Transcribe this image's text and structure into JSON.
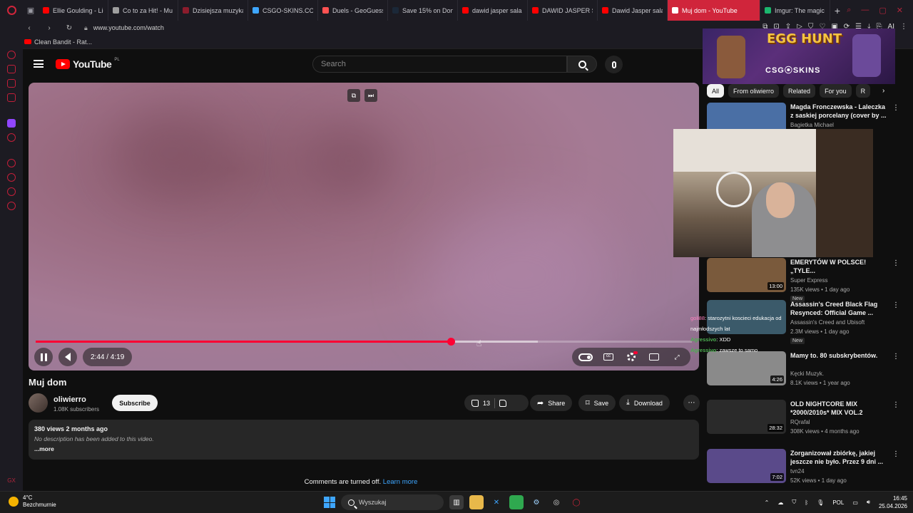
{
  "browser": {
    "tabs": [
      {
        "label": "Ellie Goulding - Lig",
        "color": "#ff0000"
      },
      {
        "label": "Co to za Hit! - Mu",
        "color": "#9e9e9e"
      },
      {
        "label": "Dzisiejsza muzyka",
        "color": "#8b1c2c"
      },
      {
        "label": "CSGO-SKINS.COM",
        "color": "#3ea6ff"
      },
      {
        "label": "Duels - GeoGuess",
        "color": "#ff5252"
      },
      {
        "label": "Save 15% on Don't",
        "color": "#1b2838"
      },
      {
        "label": "dawid jasper sala",
        "color": "#ff0000"
      },
      {
        "label": "DAWID JASPER S",
        "color": "#ff0000"
      },
      {
        "label": "Dawid Jasper sala",
        "color": "#ff0000"
      }
    ],
    "active_tab": "Muj dom - YouTube",
    "last_tab": "Imgur: The magic",
    "url": "www.youtube.com/watch",
    "bookmark": "Clean Bandit - Rat...",
    "ext_ai": "AI"
  },
  "youtube": {
    "logo": "YouTube",
    "region": "PL",
    "search_placeholder": "Search",
    "player": {
      "time": "2:44 / 4:19",
      "played_fraction": 0.633,
      "buffered_fraction": 0.765
    },
    "video": {
      "title": "Muj dom",
      "channel": "oliwierro",
      "subscribers": "1.08K subscribers",
      "subscribe_label": "Subscribe",
      "likes": "13",
      "share_label": "Share",
      "save_label": "Save",
      "download_label": "Download",
      "stats": "380 views  2 months ago",
      "description": "No description has been added to this video.",
      "more": "...more",
      "comments_off": "Comments are turned off.",
      "learn_more": "Learn more"
    },
    "ad": {
      "title": "EGG HUNT",
      "brand": "CSG⦿SKINS"
    },
    "chips": [
      "All",
      "From oliwierro",
      "Related",
      "For you",
      "R"
    ],
    "recommendations": [
      {
        "title": "Magda Fronczewska - Laleczka z saskiej porcelany (cover by ...",
        "channel": "Bagietka Michael",
        "meta": "",
        "duration": "",
        "thumb": "#4a6fa5"
      },
      {
        "title": "EMERYTÓW W POLSCE! „TYLE...",
        "channel": "Super Express",
        "meta": "135K views • 1 day ago",
        "new": "New",
        "duration": "13:00",
        "thumb": "#7a5a3c"
      },
      {
        "title": "Assassin's Creed Black Flag Resynced: Official Game ...",
        "channel": "Assassin's Creed and Ubisoft",
        "meta": "2.3M views • 1 day ago",
        "new": "New",
        "duration": "",
        "thumb": "#3b5a6a"
      },
      {
        "title": "Mamy to. 80 subskrybentów.",
        "channel": "Kęcki Muzyk.",
        "meta": "8.1K views • 1 year ago",
        "duration": "4:26",
        "thumb": "#8a8a8a"
      },
      {
        "title": "OLD NIGHTCORE MIX *2000/2010s* MIX VOL.2",
        "channel": "RQrafal",
        "meta": "308K views • 4 months ago",
        "duration": "28:32",
        "thumb": "#2a2a2a"
      },
      {
        "title": "Zorganizował zbiórkę, jakiej jeszcze nie było. Przez 9 dni ...",
        "channel": "tvn24",
        "meta": "52K views • 1 day ago",
        "duration": "7:02",
        "thumb": "#5a4a8a"
      }
    ],
    "chat": [
      {
        "user": "goli88",
        "text": ": starozytni koscieci edukacja od najmłodszych lat"
      },
      {
        "user": "Agressivo",
        "text": ": XDD"
      },
      {
        "user": "Agressivo",
        "text": ": zawsze to samo"
      }
    ]
  },
  "taskbar": {
    "temp": "4°C",
    "weather": "Bezchmurnie",
    "search": "Wyszukaj",
    "lang": "POL",
    "time": "16:45",
    "date": "25.04.2026"
  }
}
